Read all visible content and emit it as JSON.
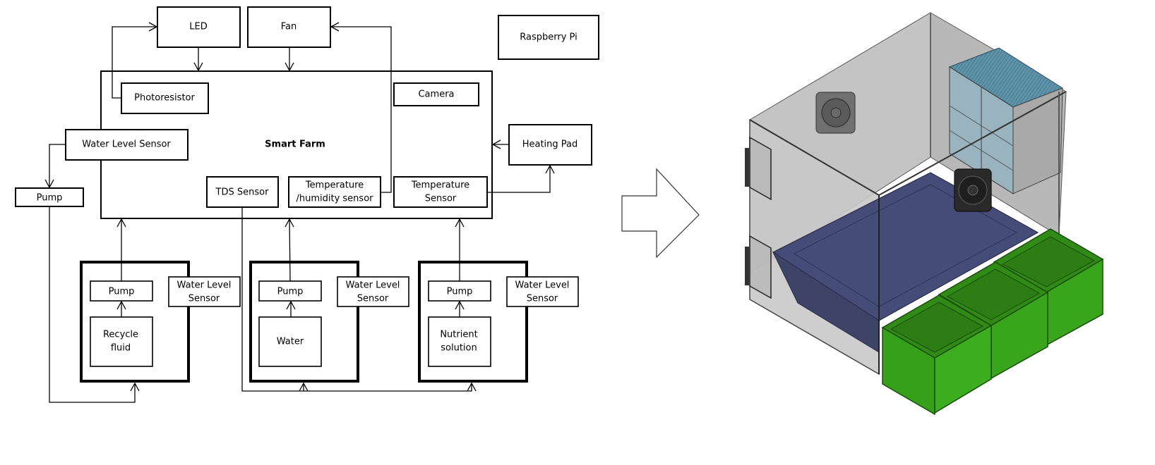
{
  "diagram": {
    "title": "Smart Farm",
    "controller": "Raspberry Pi",
    "actuators": {
      "led": "LED",
      "fan": "Fan",
      "heating_pad": "Heating Pad",
      "side_pump": "Pump"
    },
    "sensors": {
      "photoresistor": "Photoresistor",
      "water_level": "Water Level Sensor",
      "camera": "Camera",
      "tds": "TDS Sensor",
      "temp_humidity_line1": "Temperature",
      "temp_humidity_line2": "/humidity sensor",
      "temp_line1": "Temperature",
      "temp_line2": "Sensor"
    },
    "tanks": [
      {
        "pump": "Pump",
        "content_line1": "Recycle",
        "content_line2": "fluid",
        "sensor_line1": "Water Level",
        "sensor_line2": "Sensor"
      },
      {
        "pump": "Pump",
        "content_line1": "Water",
        "content_line2": "",
        "sensor_line1": "Water Level",
        "sensor_line2": "Sensor"
      },
      {
        "pump": "Pump",
        "content_line1": "Nutrient",
        "content_line2": "solution",
        "sensor_line1": "Water Level",
        "sensor_line2": "Sensor"
      }
    ],
    "colors": {
      "enclosure": "#bdbdbd",
      "basin": "#474d73",
      "planters": "#35a01c",
      "planter_edge": "#1f5a10",
      "heater": "#5a8fa8",
      "fan": "#2a2a2a"
    }
  }
}
